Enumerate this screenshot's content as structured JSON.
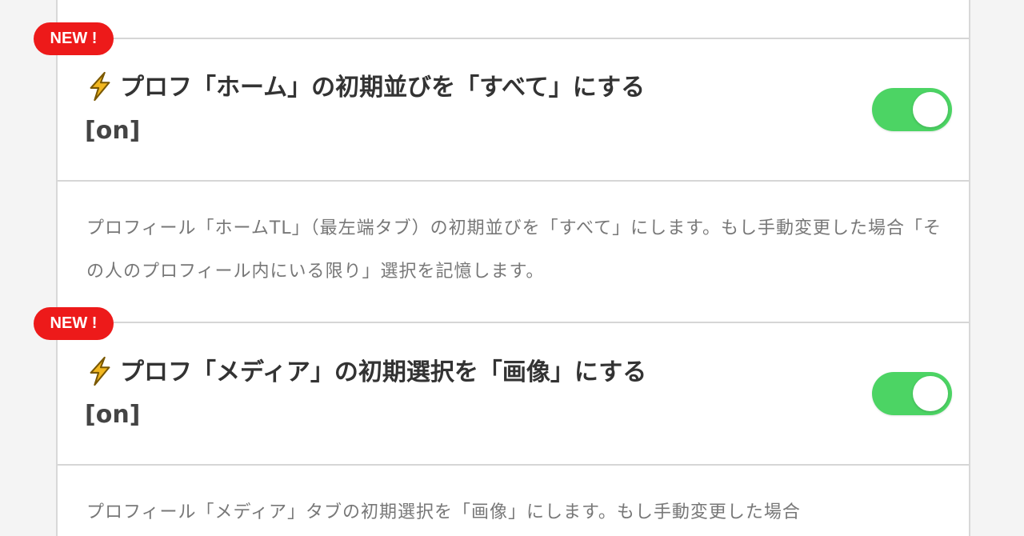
{
  "colors": {
    "badge": "#ed1a1a",
    "toggle_on": "#4cd464",
    "bolt": "#f2b720"
  },
  "settings": [
    {
      "badge": "NEW !",
      "icon": "lightning-bolt-icon",
      "title": "プロフ「ホーム」の初期並びを「すべて」にする",
      "state": "[on]",
      "enabled": true,
      "description": "プロフィール「ホームTL」（最左端タブ）の初期並びを「すべて」にします。もし手動変更した場合「その人のプロフィール内にいる限り」選択を記憶します。"
    },
    {
      "badge": "NEW !",
      "icon": "lightning-bolt-icon",
      "title": "プロフ「メディア」の初期選択を「画像」にする",
      "state": "[on]",
      "enabled": true,
      "description": "プロフィール「メディア」タブの初期選択を「画像」にします。もし手動変更した場合"
    }
  ]
}
